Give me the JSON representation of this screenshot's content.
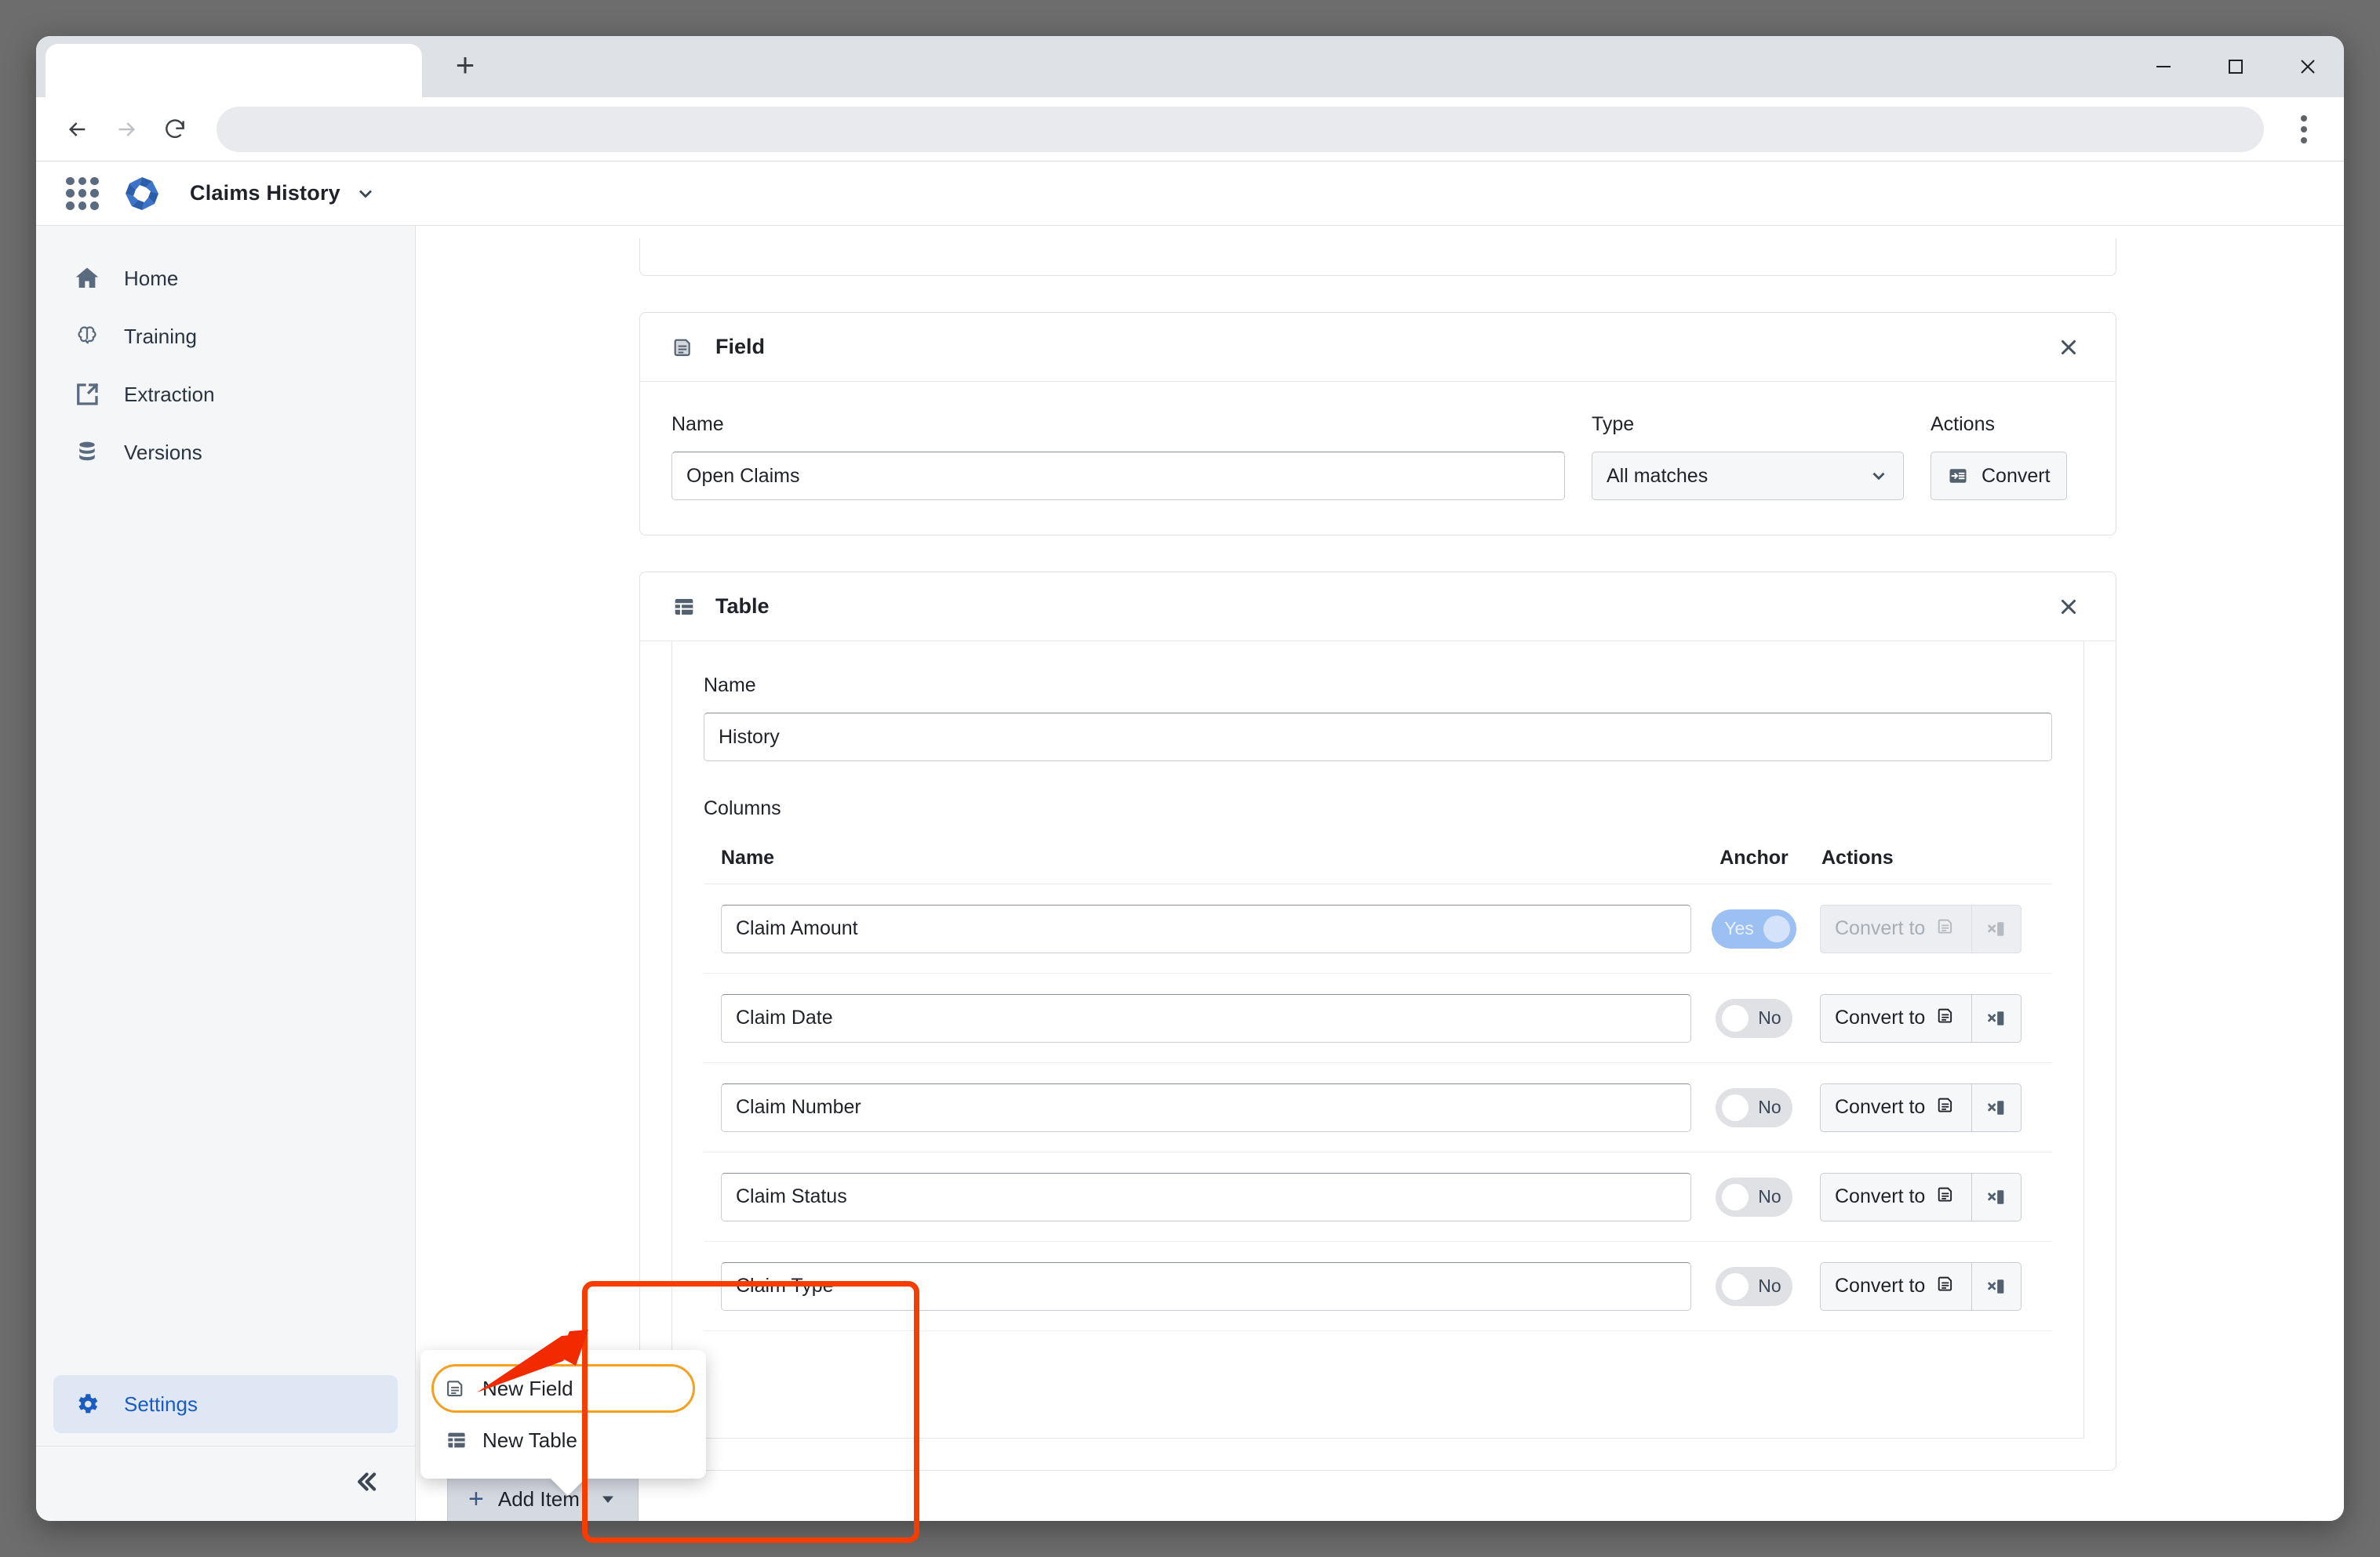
{
  "browser": {
    "tab_title": "",
    "new_tab_label": "+",
    "url_value": "",
    "url_placeholder": "",
    "nav": {
      "back": "back-arrow",
      "forward": "forward-arrow",
      "reload": "reload"
    },
    "window_controls": {
      "minimize": "minimize",
      "maximize": "maximize",
      "close": "close"
    },
    "menu": "browser-menu"
  },
  "app_header": {
    "apps_icon": "app-grid-icon",
    "logo": "brand-logo",
    "title": "Claims History",
    "caret": "chevron-down-icon"
  },
  "sidebar": {
    "items": [
      {
        "label": "Home",
        "icon": "home-icon",
        "active": false
      },
      {
        "label": "Training",
        "icon": "brain-icon",
        "active": false
      },
      {
        "label": "Extraction",
        "icon": "extraction-icon",
        "active": false
      },
      {
        "label": "Versions",
        "icon": "database-icon",
        "active": false
      }
    ],
    "bottom_item": {
      "label": "Settings",
      "icon": "gear-icon",
      "active": true
    },
    "collapse_icon": "double-chevron-left-icon"
  },
  "field_card": {
    "title": "Field",
    "icon": "field-icon",
    "close_icon": "close-icon",
    "name_label": "Name",
    "name_value": "Open Claims",
    "type_label": "Type",
    "type_value": "All matches",
    "type_caret": "chevron-down-icon",
    "actions_label": "Actions",
    "convert_label": "Convert",
    "convert_icon": "convert-icon"
  },
  "table_card": {
    "title": "Table",
    "icon": "table-icon",
    "close_icon": "close-icon",
    "name_label": "Name",
    "name_value": "History",
    "columns_label": "Columns",
    "col_headers": {
      "name": "Name",
      "anchor": "Anchor",
      "actions": "Actions"
    },
    "convert_to_label": "Convert to",
    "convert_to_icon": "field-icon",
    "remove_column_icon": "remove-column-icon",
    "rows": [
      {
        "name": "Claim Amount",
        "anchor": "Yes",
        "anchor_on": true,
        "disabled": true
      },
      {
        "name": "Claim Date",
        "anchor": "No",
        "anchor_on": false,
        "disabled": false
      },
      {
        "name": "Claim Number",
        "anchor": "No",
        "anchor_on": false,
        "disabled": false
      },
      {
        "name": "Claim Status",
        "anchor": "No",
        "anchor_on": false,
        "disabled": false
      },
      {
        "name": "Claim Type",
        "anchor": "No",
        "anchor_on": false,
        "disabled": false
      }
    ]
  },
  "add_item": {
    "label": "Add Item",
    "plus": "+",
    "caret_icon": "caret-down-icon",
    "menu": [
      {
        "label": "New Field",
        "icon": "field-icon",
        "highlighted": true
      },
      {
        "label": "New Table",
        "icon": "table-icon",
        "highlighted": false
      }
    ]
  },
  "annotations": {
    "highlight_color": "#f53d00",
    "item_highlight_color": "#f5a01e",
    "arrow": "red-pointer-arrow"
  }
}
